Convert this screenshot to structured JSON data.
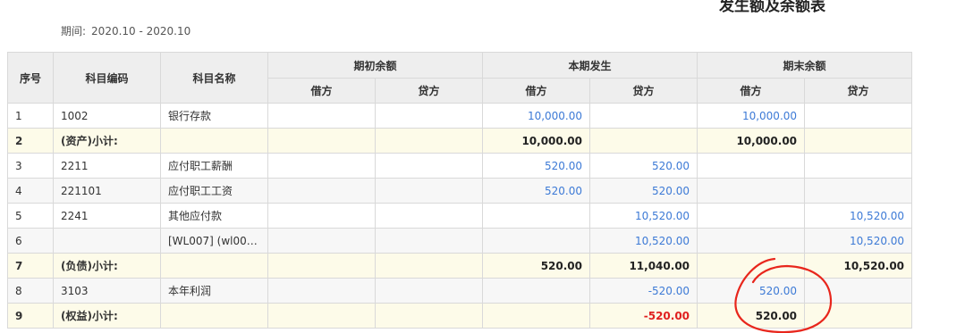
{
  "report": {
    "title": "发生额及余额表",
    "period_label": "期间:",
    "period_value": "2020.10 - 2020.10"
  },
  "table": {
    "headers": {
      "seq": "序号",
      "code": "科目编码",
      "name": "科目名称",
      "opening": "期初余额",
      "current": "本期发生",
      "closing": "期末余额",
      "debit": "借方",
      "credit": "贷方"
    },
    "rows": [
      {
        "seq": "1",
        "code": "1002",
        "name": "银行存款",
        "od": "",
        "oc": "",
        "cd": "10,000.00",
        "cc": "",
        "ed": "10,000.00",
        "ec": ""
      },
      {
        "seq": "2",
        "code": "(资产)小计:",
        "name": "",
        "od": "",
        "oc": "",
        "cd": "10,000.00",
        "cc": "",
        "ed": "10,000.00",
        "ec": ""
      },
      {
        "seq": "3",
        "code": "2211",
        "name": "应付职工薪酬",
        "od": "",
        "oc": "",
        "cd": "520.00",
        "cc": "520.00",
        "ed": "",
        "ec": ""
      },
      {
        "seq": "4",
        "code": "221101",
        "name": "应付职工工资",
        "od": "",
        "oc": "",
        "cd": "520.00",
        "cc": "520.00",
        "ed": "",
        "ec": ""
      },
      {
        "seq": "5",
        "code": "2241",
        "name": "其他应付款",
        "od": "",
        "oc": "",
        "cd": "",
        "cc": "10,520.00",
        "ed": "",
        "ec": "10,520.00"
      },
      {
        "seq": "6",
        "code": "",
        "name": "[WL007] (wl007...",
        "od": "",
        "oc": "",
        "cd": "",
        "cc": "10,520.00",
        "ed": "",
        "ec": "10,520.00"
      },
      {
        "seq": "7",
        "code": "(负债)小计:",
        "name": "",
        "od": "",
        "oc": "",
        "cd": "520.00",
        "cc": "11,040.00",
        "ed": "",
        "ec": "10,520.00"
      },
      {
        "seq": "8",
        "code": "3103",
        "name": "本年利润",
        "od": "",
        "oc": "",
        "cd": "",
        "cc": "-520.00",
        "ed": "520.00",
        "ec": ""
      },
      {
        "seq": "9",
        "code": "(权益)小计:",
        "name": "",
        "od": "",
        "oc": "",
        "cd": "",
        "cc": "-520.00",
        "ed": "520.00",
        "ec": ""
      }
    ]
  },
  "colors": {
    "link_blue": "#3d7ad6",
    "negative_red": "#e02020",
    "subtotal_bg": "#fdfbe9",
    "header_bg": "#eeeeee",
    "annotation_red": "#e8261c"
  }
}
